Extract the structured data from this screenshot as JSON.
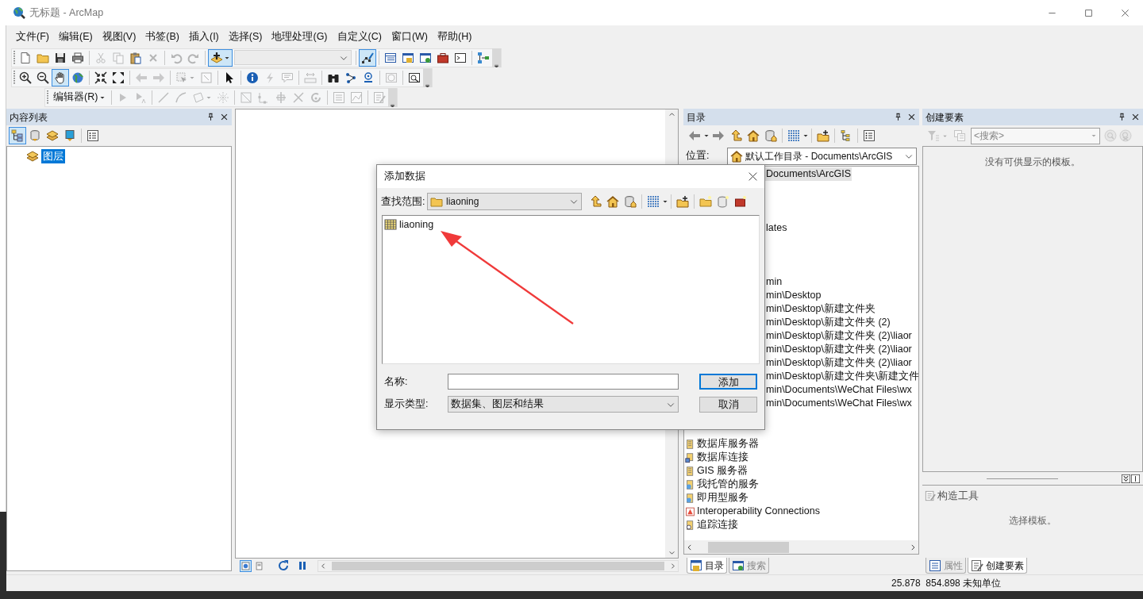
{
  "window": {
    "title": "无标题 - ArcMap"
  },
  "menu": [
    "文件(F)",
    "编辑(E)",
    "视图(V)",
    "书签(B)",
    "插入(I)",
    "选择(S)",
    "地理处理(G)",
    "自定义(C)",
    "窗口(W)",
    "帮助(H)"
  ],
  "toolbars": [
    {
      "items": [
        {
          "kind": "button",
          "disabled": false,
          "selected": false
        },
        {
          "kind": "button",
          "disabled": false,
          "selected": false
        },
        {
          "kind": "button",
          "disabled": false,
          "selected": false
        },
        {
          "kind": "button",
          "disabled": false,
          "selected": false
        },
        {
          "kind": "separator"
        },
        {
          "kind": "button",
          "disabled": true,
          "selected": false
        },
        {
          "kind": "button",
          "disabled": true,
          "selected": false
        },
        {
          "kind": "button",
          "disabled": false,
          "selected": false
        },
        {
          "kind": "button",
          "disabled": true,
          "selected": false
        },
        {
          "kind": "separator"
        },
        {
          "kind": "button",
          "disabled": true,
          "selected": false
        },
        {
          "kind": "button",
          "disabled": true,
          "selected": false
        },
        {
          "kind": "separator"
        },
        {
          "kind": "split",
          "disabled": false,
          "selected": true
        },
        {
          "kind": "combo",
          "disabled": true
        },
        {
          "kind": "separator"
        },
        {
          "kind": "button",
          "disabled": false,
          "selected": true
        },
        {
          "kind": "separator"
        },
        {
          "kind": "button",
          "disabled": false,
          "selected": false
        },
        {
          "kind": "button",
          "disabled": false,
          "selected": false
        },
        {
          "kind": "button",
          "disabled": false,
          "selected": false
        },
        {
          "kind": "button",
          "disabled": false,
          "selected": false
        },
        {
          "kind": "button",
          "disabled": false,
          "selected": false
        },
        {
          "kind": "separator"
        },
        {
          "kind": "button",
          "disabled": false,
          "selected": false
        }
      ]
    },
    {
      "items": [
        {
          "kind": "button",
          "disabled": false,
          "selected": false
        },
        {
          "kind": "button",
          "disabled": false,
          "selected": false
        },
        {
          "kind": "button",
          "disabled": false,
          "selected": true
        },
        {
          "kind": "button",
          "disabled": false,
          "selected": false
        },
        {
          "kind": "separator"
        },
        {
          "kind": "button",
          "disabled": false,
          "selected": false
        },
        {
          "kind": "button",
          "disabled": false,
          "selected": false
        },
        {
          "kind": "separator"
        },
        {
          "kind": "button",
          "disabled": true,
          "selected": false
        },
        {
          "kind": "button",
          "disabled": true,
          "selected": false
        },
        {
          "kind": "separator"
        },
        {
          "kind": "split",
          "disabled": true,
          "selected": false
        },
        {
          "kind": "button",
          "disabled": true,
          "selected": false
        },
        {
          "kind": "separator"
        },
        {
          "kind": "button",
          "disabled": false,
          "selected": false
        },
        {
          "kind": "separator"
        },
        {
          "kind": "button",
          "disabled": false,
          "selected": false
        },
        {
          "kind": "button",
          "disabled": true,
          "selected": false
        },
        {
          "kind": "button",
          "disabled": true,
          "selected": false
        },
        {
          "kind": "separator"
        },
        {
          "kind": "button",
          "disabled": true,
          "selected": false
        },
        {
          "kind": "separator"
        },
        {
          "kind": "button",
          "disabled": false,
          "selected": false
        },
        {
          "kind": "button",
          "disabled": false,
          "selected": false
        },
        {
          "kind": "button",
          "disabled": false,
          "selected": false
        },
        {
          "kind": "separator"
        },
        {
          "kind": "button",
          "disabled": true,
          "selected": false
        },
        {
          "kind": "separator"
        },
        {
          "kind": "button",
          "disabled": false,
          "selected": false
        }
      ]
    },
    {
      "items": [
        {
          "kind": "menu",
          "label": "编辑器(R)"
        },
        {
          "kind": "separator"
        },
        {
          "kind": "button",
          "disabled": true,
          "selected": false
        },
        {
          "kind": "button",
          "disabled": true,
          "selected": false
        },
        {
          "kind": "separator"
        },
        {
          "kind": "button",
          "disabled": true,
          "selected": false
        },
        {
          "kind": "button",
          "disabled": true,
          "selected": false
        },
        {
          "kind": "split",
          "disabled": true,
          "selected": false
        },
        {
          "kind": "button",
          "disabled": true,
          "selected": false
        },
        {
          "kind": "separator"
        },
        {
          "kind": "button",
          "disabled": true,
          "selected": false
        },
        {
          "kind": "button",
          "disabled": true,
          "selected": false
        },
        {
          "kind": "button",
          "disabled": true,
          "selected": false
        },
        {
          "kind": "button",
          "disabled": true,
          "selected": false
        },
        {
          "kind": "button",
          "disabled": true,
          "selected": false
        },
        {
          "kind": "separator"
        },
        {
          "kind": "button",
          "disabled": true,
          "selected": false
        },
        {
          "kind": "button",
          "disabled": true,
          "selected": false
        },
        {
          "kind": "separator"
        },
        {
          "kind": "button",
          "disabled": true,
          "selected": false
        }
      ]
    }
  ],
  "toc": {
    "title": "内容列表",
    "tools": [
      {
        "selected": true
      },
      {
        "selected": false
      },
      {
        "selected": false
      },
      {
        "selected": false
      },
      {
        "selected": false
      }
    ],
    "layers": [
      {
        "label": "图层",
        "selected": true
      }
    ]
  },
  "map": {
    "view_buttons": [
      {
        "selected": true
      },
      {
        "selected": false
      }
    ]
  },
  "catalog": {
    "title": "目录",
    "location_label": "位置:",
    "location": "默认工作目录 - Documents\\ArcGIS",
    "rows": [
      {
        "kind": "clipped",
        "label": "Documents\\ArcGIS",
        "selected": true
      },
      {
        "kind": "clipped",
        "label": "lates",
        "selected": false
      },
      {
        "kind": "clipped",
        "label": "min",
        "selected": false
      },
      {
        "kind": "clipped",
        "label": "min\\Desktop",
        "selected": false
      },
      {
        "kind": "clipped",
        "label": "min\\Desktop\\新建文件夹",
        "selected": false
      },
      {
        "kind": "clipped",
        "label": "min\\Desktop\\新建文件夹 (2)",
        "selected": false
      },
      {
        "kind": "clipped",
        "label": "min\\Desktop\\新建文件夹 (2)\\liaor",
        "selected": false
      },
      {
        "kind": "clipped",
        "label": "min\\Desktop\\新建文件夹 (2)\\liaor",
        "selected": false
      },
      {
        "kind": "clipped",
        "label": "min\\Desktop\\新建文件夹 (2)\\liaor",
        "selected": false
      },
      {
        "kind": "clipped",
        "label": "min\\Desktop\\新建文件夹\\新建文件",
        "selected": false
      },
      {
        "kind": "clipped",
        "label": "min\\Documents\\WeChat Files\\wx",
        "selected": false
      },
      {
        "kind": "clipped",
        "label": "min\\Documents\\WeChat Files\\wx",
        "selected": false
      },
      {
        "kind": "server",
        "label": "数据库服务器",
        "selected": false
      },
      {
        "kind": "connection",
        "label": "数据库连接",
        "selected": false
      },
      {
        "kind": "server",
        "label": "GIS 服务器",
        "selected": false
      },
      {
        "kind": "service",
        "label": "我托管的服务",
        "selected": false
      },
      {
        "kind": "service",
        "label": "即用型服务",
        "selected": false
      },
      {
        "kind": "interop",
        "label": "Interoperability Connections",
        "selected": false
      },
      {
        "kind": "tracking",
        "label": "追踪连接",
        "selected": false
      }
    ],
    "tabs": [
      {
        "label": "目录",
        "selected": true
      },
      {
        "label": "搜索",
        "selected": false
      }
    ]
  },
  "create_features": {
    "title": "创建要素",
    "tools": [
      {
        "disabled": true
      },
      {
        "disabled": true
      },
      {
        "disabled": true
      },
      {
        "disabled": true
      }
    ],
    "search": {
      "placeholder": "<搜索>"
    },
    "empty_message": "没有可供显示的模板。",
    "construct_title": "构造工具",
    "construct_message": "选择模板。",
    "tabs": [
      {
        "label": "属性",
        "selected": false
      },
      {
        "label": "创建要素",
        "selected": true
      }
    ]
  },
  "dialog": {
    "title": "添加数据",
    "look_in_label": "查找范围:",
    "look_in": "liaoning",
    "items": [
      {
        "label": "liaoning",
        "selected": false
      }
    ],
    "name_label": "名称:",
    "type_label": "显示类型:",
    "type": "数据集、图层和结果",
    "buttons": [
      {
        "label": "添加",
        "default": true
      },
      {
        "label": "取消",
        "default": false
      }
    ]
  },
  "status_bar": {
    "coordinates": "25.878  854.898 未知单位"
  }
}
